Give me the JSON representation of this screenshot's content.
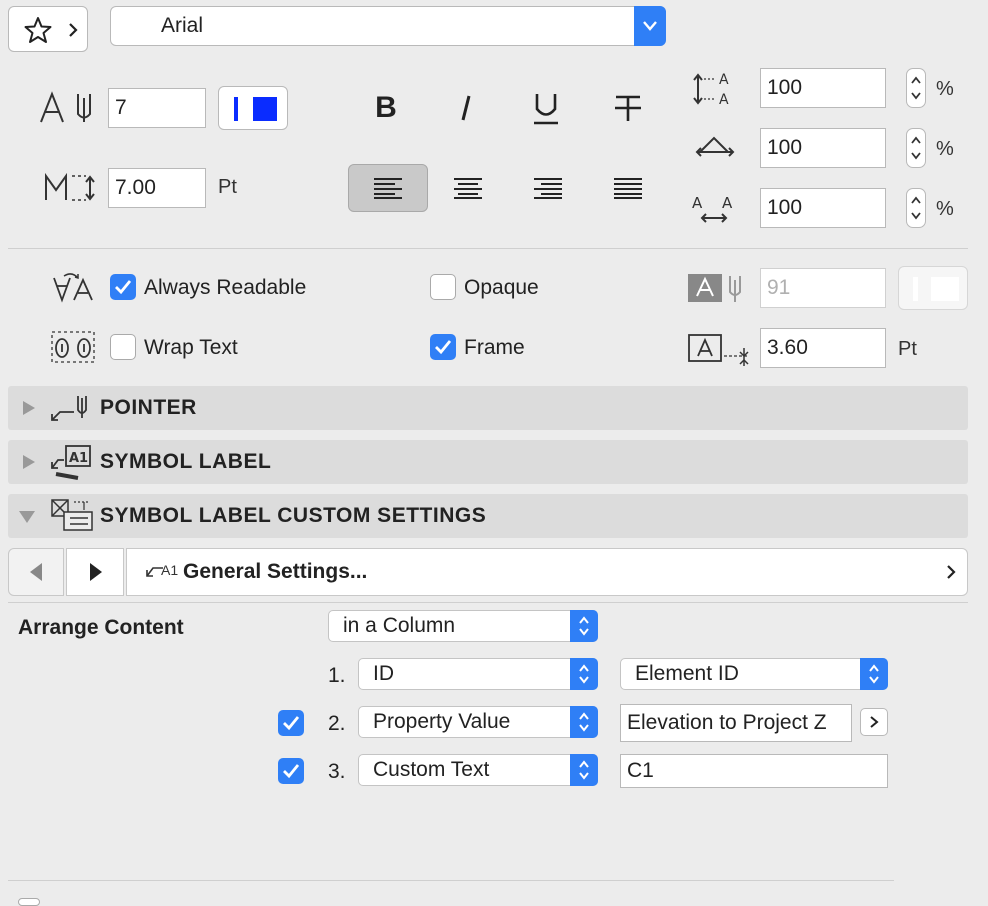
{
  "toolbar": {
    "font_name": "Arial"
  },
  "text_size": {
    "height_value": "7",
    "spacing_value": "7.00",
    "spacing_unit": "Pt"
  },
  "scales": {
    "line_spacing": "100",
    "width_factor": "100",
    "char_spacing": "100",
    "unit": "%"
  },
  "options": {
    "always_readable_label": "Always Readable",
    "always_readable_checked": true,
    "opaque_label": "Opaque",
    "opaque_checked": false,
    "wrap_text_label": "Wrap Text",
    "wrap_text_checked": false,
    "frame_label": "Frame",
    "frame_checked": true,
    "pen_value": "91",
    "frame_offset_value": "3.60",
    "frame_offset_unit": "Pt"
  },
  "sections": {
    "pointer": "POINTER",
    "symbol_label": "SYMBOL LABEL",
    "custom_settings": "SYMBOL LABEL CUSTOM SETTINGS"
  },
  "nav": {
    "general_settings": "General Settings...",
    "icon_text": "A1"
  },
  "arrange": {
    "label": "Arrange Content",
    "mode": "in a Column",
    "rows": [
      {
        "num": "1.",
        "checked": null,
        "type": "ID",
        "value": "Element ID",
        "value_kind": "popup"
      },
      {
        "num": "2.",
        "checked": true,
        "type": "Property Value",
        "value": "Elevation to Project Z",
        "value_kind": "field-more"
      },
      {
        "num": "3.",
        "checked": true,
        "type": "Custom Text",
        "value": "C1",
        "value_kind": "field"
      }
    ]
  },
  "colors": {
    "accent": "#2f7ff6",
    "pen_color": "#0a2cff"
  }
}
